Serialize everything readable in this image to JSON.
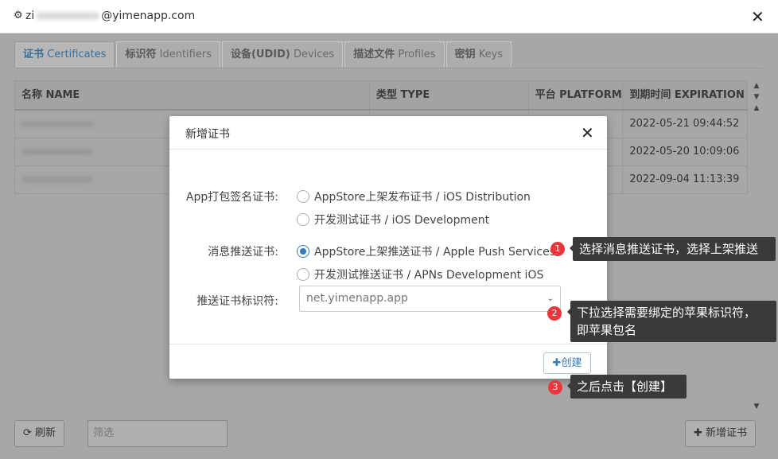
{
  "titlebar": {
    "account_prefix": "zi",
    "account_suffix": "@yimenapp.com",
    "close": "✕",
    "gear": "⚙"
  },
  "tabs": [
    {
      "cn": "证书",
      "en": "Certificates"
    },
    {
      "cn": "标识符",
      "en": "Identifiers"
    },
    {
      "cn": "设备(UDID)",
      "en": "Devices"
    },
    {
      "cn": "描述文件",
      "en": "Profiles"
    },
    {
      "cn": "密钥",
      "en": "Keys"
    }
  ],
  "table": {
    "headers": [
      "名称 NAME",
      "类型 TYPE",
      "平台 PLATFORM",
      "到期时间 EXPIRATION"
    ],
    "rows": [
      {
        "expiration": "2022-05-21 09:44:52"
      },
      {
        "expiration": "2022-05-20 10:09:06"
      },
      {
        "expiration": "2022-09-04 11:13:39"
      }
    ]
  },
  "footer": {
    "refresh": "刷新",
    "filter_placeholder": "筛选",
    "add_cert": "新增证书"
  },
  "modal": {
    "title": "新增证书",
    "close": "✕",
    "sign_label": "App打包签名证书:",
    "sign_options": [
      "AppStore上架发布证书 / iOS Distribution",
      "开发测试证书 / iOS Development"
    ],
    "push_label": "消息推送证书:",
    "push_options": [
      "AppStore上架推送证书 / Apple Push Services",
      "开发测试推送证书 / APNs Development iOS"
    ],
    "bundle_label": "推送证书标识符:",
    "bundle_value": "net.yimenapp.app",
    "create": "创建"
  },
  "tips": [
    {
      "num": "1",
      "text": "选择消息推送证书，选择上架推送"
    },
    {
      "num": "2",
      "text": "下拉选择需要绑定的苹果标识符，",
      "text2": "即苹果包名"
    },
    {
      "num": "3",
      "text": "之后点击【创建】"
    }
  ]
}
